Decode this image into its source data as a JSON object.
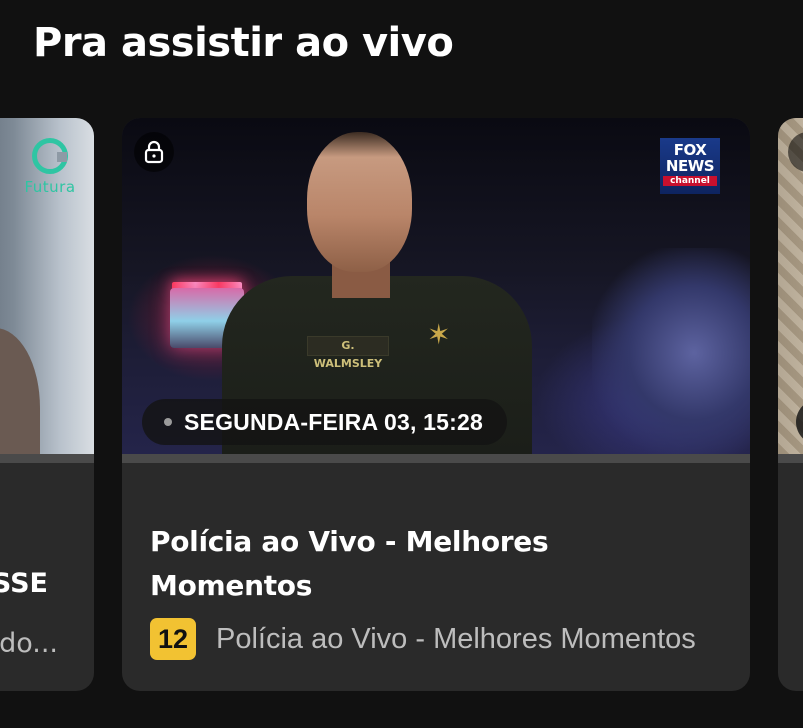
{
  "section": {
    "title": "Pra assistir ao vivo"
  },
  "cards": {
    "left": {
      "channel_logo_text": "Futura",
      "title_fragment": "SSE",
      "subtitle_fragment": "do..."
    },
    "main": {
      "channel_logo": {
        "line1": "FOX",
        "line2": "NEWS",
        "line3": "channel"
      },
      "nameplate_text": "G. WALMSLEY",
      "schedule": "SEGUNDA-FEIRA 03, 15:28",
      "title": "Polícia ao Vivo - Melhores Momentos",
      "age_rating": "12",
      "program_name": "Polícia ao Vivo - Melhores Momentos",
      "progress_fraction": 0.0
    },
    "right": {}
  },
  "icons": {
    "lock": "lock-icon",
    "live_indicator": "live-dot-icon"
  },
  "colors": {
    "background": "#111111",
    "card": "#2a2a2a",
    "age_rating_12": "#f2c232",
    "futura_green": "#2fc5a3"
  }
}
